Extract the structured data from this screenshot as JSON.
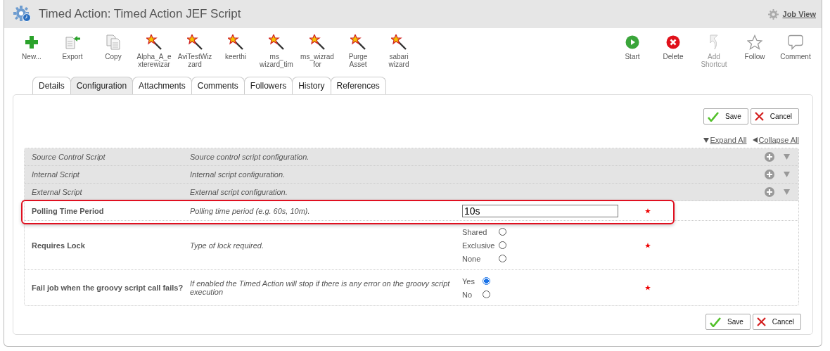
{
  "window": {
    "title": "Timed Action: Timed Action JEF Script",
    "link": "Job View"
  },
  "toolbar": {
    "left": [
      {
        "kind": "new",
        "label": "New..."
      },
      {
        "kind": "export",
        "label": "Export"
      },
      {
        "kind": "copy",
        "label": "Copy"
      },
      {
        "kind": "wizard",
        "label": "Alpha_A_e xterewizar"
      },
      {
        "kind": "wizard",
        "label": "AviTestWiz zard"
      },
      {
        "kind": "wizard",
        "label": "keerthi"
      },
      {
        "kind": "wizard",
        "label": "ms_ wizard_tim"
      },
      {
        "kind": "wizard",
        "label": "ms_wizrad for"
      },
      {
        "kind": "wizard",
        "label": "Purge Asset"
      },
      {
        "kind": "wizard",
        "label": "sabari wizard"
      }
    ],
    "right": [
      {
        "kind": "start",
        "label": "Start"
      },
      {
        "kind": "delete",
        "label": "Delete"
      },
      {
        "kind": "shortcut",
        "label": "Add Shortcut",
        "disabled": true
      },
      {
        "kind": "follow",
        "label": "Follow"
      },
      {
        "kind": "comment",
        "label": "Comment"
      }
    ]
  },
  "tabs": [
    {
      "label": "Details",
      "selected": false
    },
    {
      "label": "Configuration",
      "selected": true
    },
    {
      "label": "Attachments",
      "selected": false
    },
    {
      "label": "Comments",
      "selected": false
    },
    {
      "label": "Followers",
      "selected": false
    },
    {
      "label": "History",
      "selected": false
    },
    {
      "label": "References",
      "selected": false
    }
  ],
  "actions_top": {
    "save": "Save",
    "cancel": "Cancel"
  },
  "expand_all": "Expand All",
  "collapse_all": "Collapse All",
  "rows": [
    {
      "kind": "section",
      "label": "Source Control Script",
      "description": "Source control script configuration."
    },
    {
      "kind": "section",
      "label": "Internal Script",
      "description": "Internal script configuration."
    },
    {
      "kind": "section",
      "label": "External Script",
      "description": "External script configuration."
    },
    {
      "kind": "text",
      "label": "Polling Time Period",
      "description": "Polling time period (e.g. 60s, 10m).",
      "value": "10s",
      "required": true,
      "highlighted": true
    },
    {
      "kind": "radio",
      "label": "Requires Lock",
      "description": "Type of lock required.",
      "required": true,
      "highlighted": false,
      "options": [
        {
          "label": "Shared",
          "selected": false
        },
        {
          "label": "Exclusive",
          "selected": false
        },
        {
          "label": "None",
          "selected": false
        }
      ]
    },
    {
      "kind": "radio",
      "label": "Fail job when the groovy script call fails?",
      "description": "If enabled the Timed Action will stop if there is any error on the groovy script execution",
      "required": true,
      "highlighted": false,
      "options": [
        {
          "label": "Yes",
          "selected": true
        },
        {
          "label": "No",
          "selected": false
        }
      ]
    }
  ],
  "actions_bottom": {
    "save": "Save",
    "cancel": "Cancel"
  }
}
